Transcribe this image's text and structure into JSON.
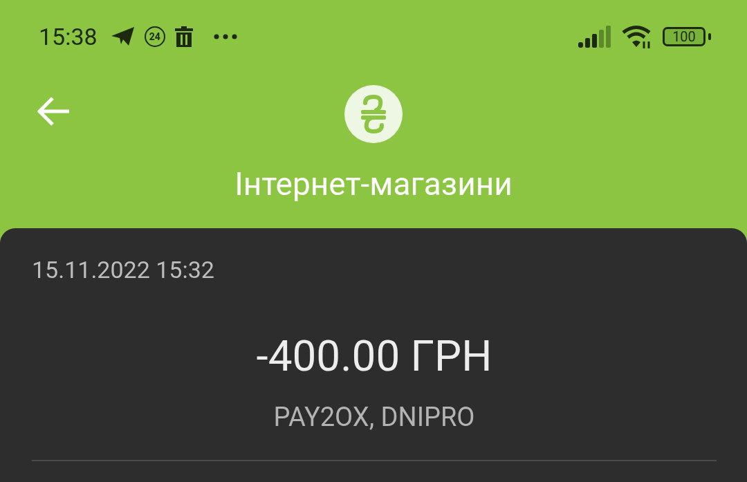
{
  "status_bar": {
    "time": "15:38",
    "notification_badge": "24",
    "battery": "100"
  },
  "header": {
    "title": "Інтернет-магазини"
  },
  "transaction": {
    "datetime": "15.11.2022 15:32",
    "amount": "-400.00 ГРН",
    "merchant": "PAY2OX, DNIPRO"
  }
}
